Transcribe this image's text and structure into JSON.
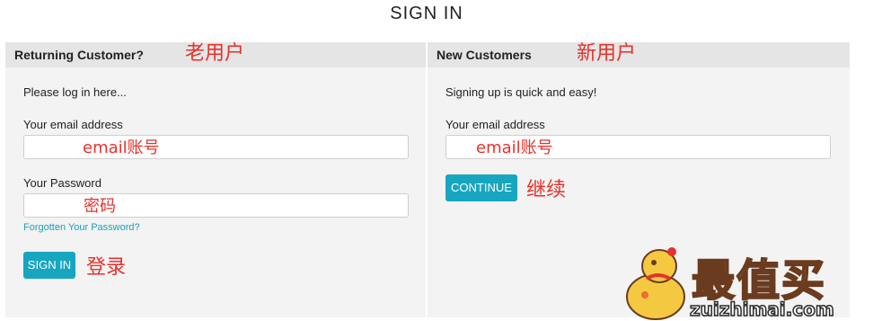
{
  "page": {
    "title": "SIGN IN"
  },
  "returning": {
    "header": "Returning Customer?",
    "header_annotation": "老用户",
    "intro": "Please log in here...",
    "email_label": "Your email address",
    "email_annotation": "email账号",
    "password_label": "Your Password",
    "password_annotation": "密码",
    "forgot_link": "Forgotten Your Password?",
    "sign_in_button": "SIGN IN",
    "sign_in_annotation": "登录"
  },
  "new_customer": {
    "header": "New Customers",
    "header_annotation": "新用户",
    "intro": "Signing up is quick and easy!",
    "email_label": "Your email address",
    "email_annotation": "email账号",
    "continue_button": "CONTINUE",
    "continue_annotation": "继续"
  },
  "watermark": {
    "logo_text": "最值买",
    "url_text": "zuizhimai.com"
  },
  "colors": {
    "accent": "#17a6bf",
    "annotation": "#e8312b",
    "panel_bg": "#f3f3f3",
    "panel_header_bg": "#e5e5e5"
  }
}
